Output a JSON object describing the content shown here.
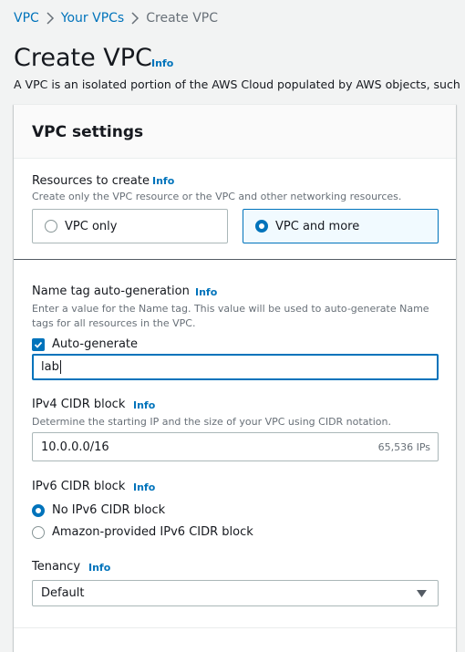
{
  "breadcrumb": {
    "items": [
      {
        "label": "VPC"
      },
      {
        "label": "Your VPCs"
      },
      {
        "label": "Create VPC"
      }
    ]
  },
  "header": {
    "title": "Create VPC",
    "info": "Info",
    "description": "A VPC is an isolated portion of the AWS Cloud populated by AWS objects, such"
  },
  "panel": {
    "title": "VPC settings",
    "resources": {
      "label": "Resources to create",
      "info": "Info",
      "hint": "Create only the VPC resource or the VPC and other networking resources.",
      "options": [
        {
          "label": "VPC only",
          "selected": false
        },
        {
          "label": "VPC and more",
          "selected": true
        }
      ]
    },
    "name_tag": {
      "label": "Name tag auto-generation",
      "info": "Info",
      "hint_line1": "Enter a value for the Name tag. This value will be used to auto-generate Name",
      "hint_line2": "tags for all resources in the VPC.",
      "checkbox_label": "Auto-generate",
      "checked": true,
      "value": "lab"
    },
    "ipv4": {
      "label": "IPv4 CIDR block",
      "info": "Info",
      "hint": "Determine the starting IP and the size of your VPC using CIDR notation.",
      "value": "10.0.0.0/16",
      "ip_count": "65,536 IPs"
    },
    "ipv6": {
      "label": "IPv6 CIDR block",
      "info": "Info",
      "options": [
        {
          "label": "No IPv6 CIDR block",
          "selected": true
        },
        {
          "label": "Amazon-provided IPv6 CIDR block",
          "selected": false
        }
      ]
    },
    "tenancy": {
      "label": "Tenancy",
      "info": "Info",
      "value": "Default"
    }
  },
  "colors": {
    "accent": "#0073bb",
    "background": "#f2f3f3",
    "text": "#16191f",
    "muted": "#687078"
  }
}
